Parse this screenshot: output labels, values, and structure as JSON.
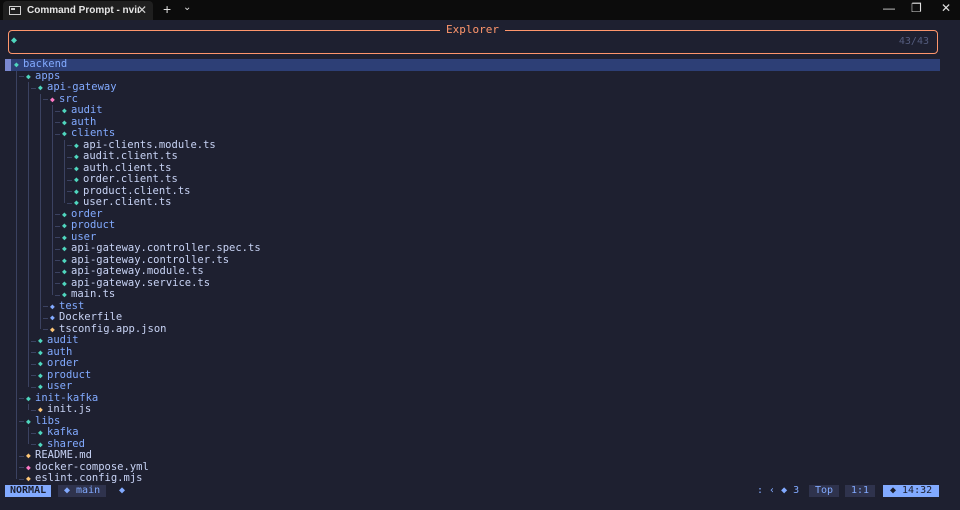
{
  "window": {
    "tab_title": "Command Prompt - nvim .",
    "tab_close": "✕",
    "new_tab": "+",
    "tab_dropdown": "⌄",
    "minimize": "—",
    "restore": "❐",
    "close": "✕"
  },
  "picker": {
    "title": "Explorer",
    "prompt": "◆",
    "count": "43/43"
  },
  "tree": [
    {
      "label": "backend",
      "depth": 0,
      "type": "dir",
      "selected": true
    },
    {
      "label": "apps",
      "depth": 1,
      "type": "dir"
    },
    {
      "label": "api-gateway",
      "depth": 2,
      "type": "dir"
    },
    {
      "label": "src",
      "depth": 3,
      "type": "dir",
      "iconColor": "#ff79c6"
    },
    {
      "label": "audit",
      "depth": 4,
      "type": "dir"
    },
    {
      "label": "auth",
      "depth": 4,
      "type": "dir"
    },
    {
      "label": "clients",
      "depth": 4,
      "type": "dir"
    },
    {
      "label": "api-clients.module.ts",
      "depth": 5,
      "type": "file"
    },
    {
      "label": "audit.client.ts",
      "depth": 5,
      "type": "file"
    },
    {
      "label": "auth.client.ts",
      "depth": 5,
      "type": "file"
    },
    {
      "label": "order.client.ts",
      "depth": 5,
      "type": "file"
    },
    {
      "label": "product.client.ts",
      "depth": 5,
      "type": "file"
    },
    {
      "label": "user.client.ts",
      "depth": 5,
      "type": "file"
    },
    {
      "label": "order",
      "depth": 4,
      "type": "dir"
    },
    {
      "label": "product",
      "depth": 4,
      "type": "dir"
    },
    {
      "label": "user",
      "depth": 4,
      "type": "dir"
    },
    {
      "label": "api-gateway.controller.spec.ts",
      "depth": 4,
      "type": "file"
    },
    {
      "label": "api-gateway.controller.ts",
      "depth": 4,
      "type": "file"
    },
    {
      "label": "api-gateway.module.ts",
      "depth": 4,
      "type": "file"
    },
    {
      "label": "api-gateway.service.ts",
      "depth": 4,
      "type": "file"
    },
    {
      "label": "main.ts",
      "depth": 4,
      "type": "file"
    },
    {
      "label": "test",
      "depth": 3,
      "type": "dir",
      "iconColor": "#82aaff"
    },
    {
      "label": "Dockerfile",
      "depth": 3,
      "type": "file",
      "iconColor": "#82aaff"
    },
    {
      "label": "tsconfig.app.json",
      "depth": 3,
      "type": "file",
      "iconColor": "#ffc777"
    },
    {
      "label": "audit",
      "depth": 2,
      "type": "dir"
    },
    {
      "label": "auth",
      "depth": 2,
      "type": "dir"
    },
    {
      "label": "order",
      "depth": 2,
      "type": "dir"
    },
    {
      "label": "product",
      "depth": 2,
      "type": "dir"
    },
    {
      "label": "user",
      "depth": 2,
      "type": "dir"
    },
    {
      "label": "init-kafka",
      "depth": 1,
      "type": "dir"
    },
    {
      "label": "init.js",
      "depth": 2,
      "type": "file",
      "iconColor": "#ffc777"
    },
    {
      "label": "libs",
      "depth": 1,
      "type": "dir"
    },
    {
      "label": "kafka",
      "depth": 2,
      "type": "dir"
    },
    {
      "label": "shared",
      "depth": 2,
      "type": "dir"
    },
    {
      "label": "README.md",
      "depth": 1,
      "type": "file",
      "iconColor": "#ffc777"
    },
    {
      "label": "docker-compose.yml",
      "depth": 1,
      "type": "file",
      "iconColor": "#ff79c6"
    },
    {
      "label": "eslint.config.mjs",
      "depth": 1,
      "type": "file",
      "iconColor": "#ffc777"
    }
  ],
  "statusline": {
    "mode": "NORMAL",
    "branch": "◆ main",
    "branch_end": "◆",
    "lsp": ": ‹ ◆ 3",
    "progress": "Top",
    "location": "1:1",
    "clock": "◆ 14:32"
  },
  "colors": {
    "dir_icon": "#4fd6be",
    "dir_text": "#82aaff",
    "file_text": "#c8d3f5",
    "border": "#ff966c",
    "selection": "#2d3f76"
  }
}
